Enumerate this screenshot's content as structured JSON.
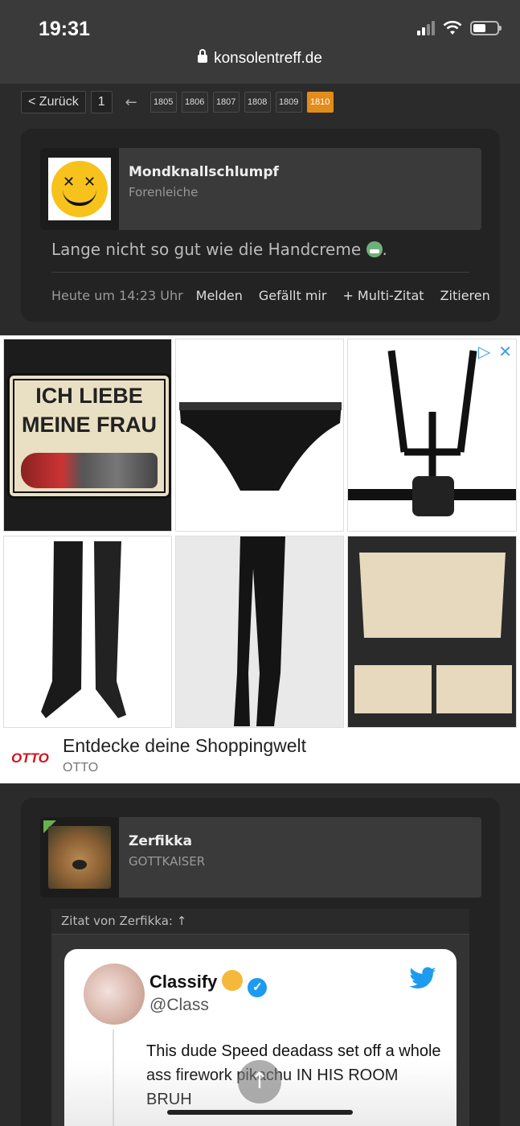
{
  "status_bar": {
    "time": "19:31"
  },
  "browser": {
    "url": "konsolentreff.de"
  },
  "pagination": {
    "back_label": "< Zurück",
    "first_page": "1",
    "arrow": "←",
    "pages": [
      "1805",
      "1806",
      "1807",
      "1808",
      "1809",
      "1810"
    ],
    "active_page": "1810"
  },
  "post1": {
    "username": "Mondknallschlumpf",
    "rank": "Forenleiche",
    "message": "Lange nicht so gut wie die Handcreme",
    "message_suffix": ".",
    "timestamp": "Heute um 14:23 Uhr",
    "actions": {
      "report": "Melden",
      "like": "Gefällt mir",
      "multi_quote": "+ Multi-Zitat",
      "quote": "Zitieren"
    }
  },
  "ad": {
    "sign_line1": "ICH LIEBE",
    "sign_line2": "MEINE FRAU",
    "brand_logo": "OTTO",
    "title": "Entdecke deine Shoppingwelt",
    "advertiser": "OTTO",
    "accent_color": "#3aa0e0"
  },
  "post2": {
    "username": "Zerfikka",
    "rank": "GOTTKAISER",
    "quote_header": "Zitat von Zerfikka: ↑",
    "tweet": {
      "name": "Classify",
      "handle": "@Class",
      "text": "This dude Speed deadass set off a whole ass firework pikachu IN HIS ROOM BRUH"
    }
  },
  "colors": {
    "active_page": "#e28c1a",
    "background": "#2b2b2b"
  }
}
